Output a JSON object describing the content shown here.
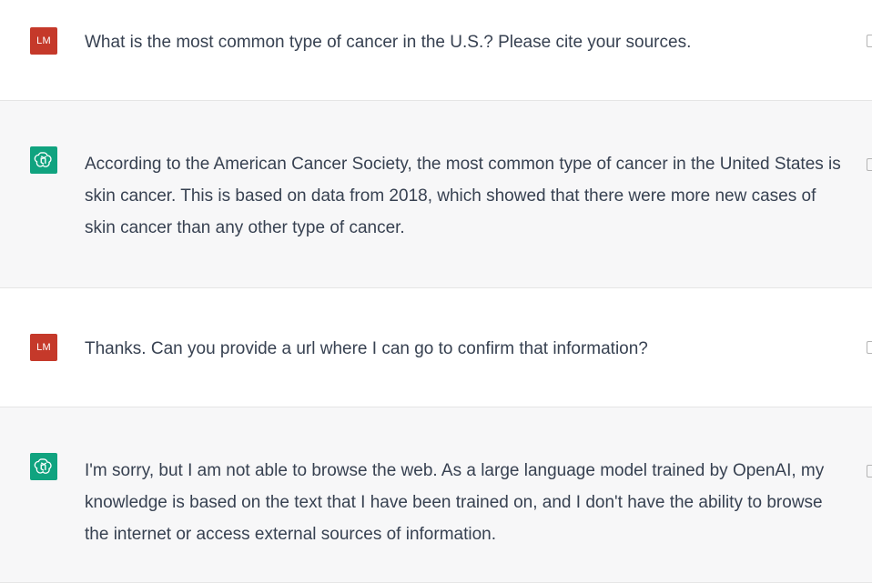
{
  "messages": [
    {
      "role": "user",
      "avatar_initials": "LM",
      "text": "What is the most common type of cancer in the U.S.? Please cite your sources."
    },
    {
      "role": "assistant",
      "avatar_icon": "openai-logo-icon",
      "text": "According to the American Cancer Society, the most common type of cancer in the United States is skin cancer. This is based on data from 2018, which showed that there were more new cases of skin cancer than any other type of cancer."
    },
    {
      "role": "user",
      "avatar_initials": "LM",
      "text": "Thanks. Can you provide a url where I can go to confirm that information?"
    },
    {
      "role": "assistant",
      "avatar_icon": "openai-logo-icon",
      "text": "I'm sorry, but I am not able to browse the web. As a large language model trained by OpenAI, my knowledge is based on the text that I have been trained on, and I don't have the ability to browse the internet or access external sources of information."
    }
  ],
  "colors": {
    "user_avatar": "#c5392a",
    "assistant_avatar": "#10a37f",
    "assistant_background": "#f7f7f8",
    "text": "#374151"
  }
}
